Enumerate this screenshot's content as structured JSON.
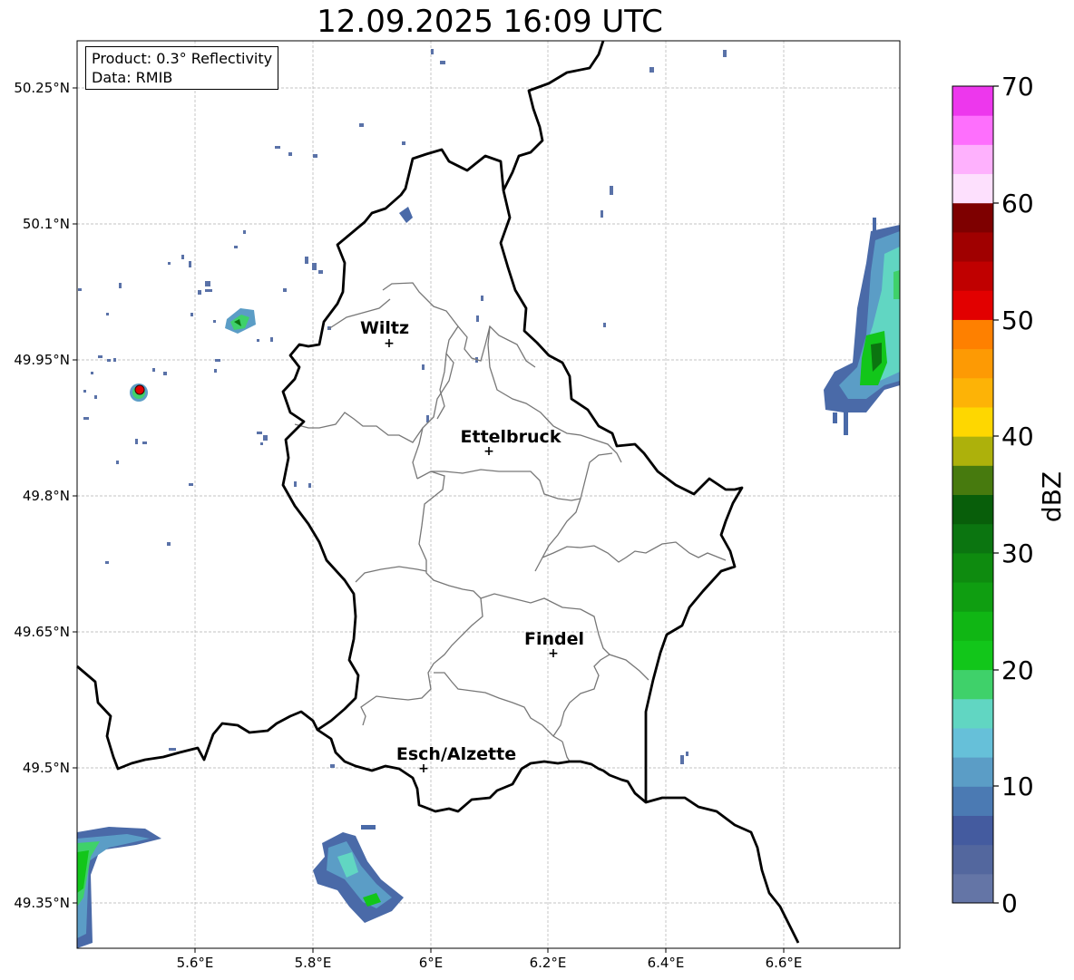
{
  "title": "12.09.2025 16:09 UTC",
  "info": {
    "product": "Product: 0.3° Reflectivity",
    "data_source": "Data: RMIB"
  },
  "axes": {
    "lon_ticks": [
      "5.6°E",
      "5.8°E",
      "6°E",
      "6.2°E",
      "6.4°E",
      "6.6°E"
    ],
    "lat_ticks": [
      "50.25°N",
      "50.1°N",
      "49.95°N",
      "49.8°N",
      "49.65°N",
      "49.5°N",
      "49.35°N"
    ]
  },
  "cities": [
    {
      "name": "Wiltz",
      "lon": 5.93,
      "lat": 49.97
    },
    {
      "name": "Ettelbruck",
      "lon": 6.1,
      "lat": 49.85
    },
    {
      "name": "Findel",
      "lon": 6.21,
      "lat": 49.627
    },
    {
      "name": "Esch/Alzette",
      "lon": 5.99,
      "lat": 49.5
    }
  ],
  "colorbar": {
    "label": "dBZ",
    "tick_labels": [
      "0",
      "10",
      "20",
      "30",
      "40",
      "50",
      "60",
      "70"
    ],
    "min": 0,
    "max": 70,
    "colors": [
      "#6475a6",
      "#53679e",
      "#445b9f",
      "#4b7ab3",
      "#5b9dc6",
      "#66c0d9",
      "#61d6c2",
      "#3fd16a",
      "#12c61a",
      "#10b614",
      "#0f9e11",
      "#0e8b0f",
      "#0b7510",
      "#085e0a",
      "#477a0e",
      "#adb10b",
      "#fed700",
      "#fdb306",
      "#fd9a04",
      "#fe8000",
      "#e20000",
      "#c00000",
      "#a00000",
      "#7e0000",
      "#fde0fd",
      "#feb1fd",
      "#fe6ffd",
      "#ed37ed"
    ]
  }
}
